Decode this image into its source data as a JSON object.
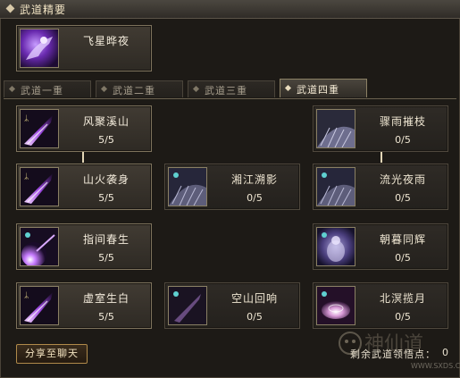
{
  "header": {
    "title": "武道精要"
  },
  "featured": {
    "name": "飞星晔夜",
    "icon": "purple-rider-icon"
  },
  "tabs": [
    {
      "label": "武道一重",
      "active": false
    },
    {
      "label": "武道二重",
      "active": false
    },
    {
      "label": "武道三重",
      "active": false
    },
    {
      "label": "武道四重",
      "active": true
    }
  ],
  "skills": [
    {
      "name": "风聚溪山",
      "level": "5/5",
      "icon": "purple-slash-icon"
    },
    {
      "name": "骤雨摧枝",
      "level": "0/5",
      "icon": "grey-rain-icon"
    },
    {
      "name": "山火袭身",
      "level": "5/5",
      "icon": "purple-slash-icon"
    },
    {
      "name": "湘江溯影",
      "level": "0/5",
      "icon": "grey-rain-icon"
    },
    {
      "name": "流光夜雨",
      "level": "0/5",
      "icon": "grey-rain-icon"
    },
    {
      "name": "指间春生",
      "level": "5/5",
      "icon": "purple-orb-icon"
    },
    {
      "name": "朝暮同辉",
      "level": "0/5",
      "icon": "violet-figure-icon"
    },
    {
      "name": "虚室生白",
      "level": "5/5",
      "icon": "purple-slash-icon"
    },
    {
      "name": "空山回响",
      "level": "0/5",
      "icon": "dark-slash-icon"
    },
    {
      "name": "北溟揽月",
      "level": "0/5",
      "icon": "pink-vortex-icon"
    }
  ],
  "footer": {
    "share_label": "分享至聊天",
    "remaining_label": "剩余武道领悟点：",
    "remaining_value": "0",
    "watermark_text": "WWW.SXDS.COM"
  }
}
